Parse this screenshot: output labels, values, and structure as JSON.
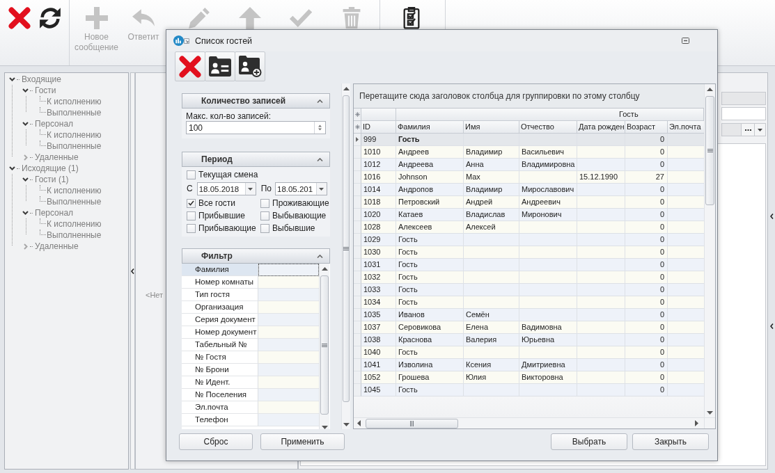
{
  "toolbar": {
    "groups": [
      {
        "buttons": [
          {
            "kind": "close",
            "disabled": false
          },
          {
            "kind": "refresh",
            "disabled": false
          }
        ]
      },
      {
        "buttons": [
          {
            "kind": "new",
            "label": "Новое сообщение",
            "disabled": true
          },
          {
            "kind": "reply",
            "label": "Ответит",
            "disabled": true
          },
          {
            "kind": "edit",
            "disabled": true
          },
          {
            "kind": "up",
            "disabled": true
          },
          {
            "kind": "confirm",
            "disabled": true
          },
          {
            "kind": "delete",
            "disabled": true
          }
        ]
      },
      {
        "buttons": [
          {
            "kind": "checklist",
            "disabled": false
          }
        ]
      }
    ]
  },
  "tree": [
    {
      "label": "Входящие",
      "expanded": true,
      "children": [
        {
          "label": "Гости",
          "expanded": true,
          "children": [
            {
              "label": "К исполнению"
            },
            {
              "label": "Выполненные"
            }
          ]
        },
        {
          "label": "Персонал",
          "expanded": true,
          "children": [
            {
              "label": "К исполнению"
            },
            {
              "label": "Выполненные"
            }
          ]
        },
        {
          "label": "Удаленные",
          "expanded": false
        }
      ]
    },
    {
      "label": "Исходящие (1)",
      "expanded": true,
      "children": [
        {
          "label": "Гости (1)",
          "expanded": true,
          "children": [
            {
              "label": "К исполнению"
            },
            {
              "label": "Выполненные"
            }
          ]
        },
        {
          "label": "Персонал",
          "expanded": true,
          "children": [
            {
              "label": "К исполнению"
            },
            {
              "label": "Выполненные"
            }
          ]
        },
        {
          "label": "Удаленные",
          "expanded": false
        }
      ]
    }
  ],
  "middle_panel": {
    "empty_text": "<Нет"
  },
  "dialog": {
    "title": "Список гостей",
    "toolbar": [
      {
        "kind": "close"
      },
      {
        "kind": "card"
      },
      {
        "kind": "add"
      }
    ],
    "records_group": {
      "title": "Количество записей",
      "expanded": true,
      "max_label": "Макс. кол-во записей:",
      "max_value": "100"
    },
    "period_group": {
      "title": "Период",
      "expanded": true,
      "current_shift": {
        "label": "Текущая смена",
        "checked": false
      },
      "from_label": "С",
      "from_date": "18.05.2018",
      "to_label": "По",
      "to_date": "18.05.201",
      "options": [
        {
          "label": "Все гости",
          "checked": true
        },
        {
          "label": "Проживающие",
          "checked": false
        },
        {
          "label": "Прибывшие",
          "checked": false
        },
        {
          "label": "Выбывающие",
          "checked": false
        },
        {
          "label": "Прибывающие",
          "checked": false
        },
        {
          "label": "Выбывшие",
          "checked": false
        }
      ]
    },
    "filter_group": {
      "title": "Фильтр",
      "expanded": true,
      "fields": [
        {
          "label": "Фамилия",
          "selected": true
        },
        {
          "label": "Номер комнаты",
          "selected": false
        },
        {
          "label": "Тип гостя",
          "selected": false
        },
        {
          "label": "Организация",
          "selected": false
        },
        {
          "label": "Серия документ",
          "selected": false
        },
        {
          "label": "Номер документ",
          "selected": false
        },
        {
          "label": "Табельный №",
          "selected": false
        },
        {
          "label": "№ Гостя",
          "selected": false
        },
        {
          "label": "№ Брони",
          "selected": false
        },
        {
          "label": "№ Идент.",
          "selected": false
        },
        {
          "label": "№ Поселения",
          "selected": false
        },
        {
          "label": "Эл.почта",
          "selected": false
        },
        {
          "label": "Телефон",
          "selected": false
        }
      ]
    },
    "left_buttons": [
      "Сброс",
      "Применить"
    ],
    "grid": {
      "group_hint": "Перетащите сюда заголовок столбца для группировки по этому столбцу",
      "band": "Гость",
      "columns": [
        "ID",
        "Фамилия",
        "Имя",
        "Отчество",
        "Дата рожден",
        "Возраст",
        "Эл.почта"
      ],
      "rows": [
        {
          "id": "999",
          "last_name": "Гость",
          "age": "0",
          "selected": true
        },
        {
          "id": "1010",
          "last_name": "Андреев",
          "first_name": "Владимир",
          "middle_name": "Васильевич",
          "age": "0",
          "selected": false
        },
        {
          "id": "1012",
          "last_name": "Андреева",
          "first_name": "Анна",
          "middle_name": "Владимировна",
          "age": "0",
          "selected": false
        },
        {
          "id": "1016",
          "last_name": "Johnson",
          "first_name": "Max",
          "birth_date": "15.12.1990",
          "age": "27",
          "selected": false
        },
        {
          "id": "1014",
          "last_name": "Андропов",
          "first_name": "Владимир",
          "middle_name": "Мирославович",
          "age": "0",
          "selected": false
        },
        {
          "id": "1018",
          "last_name": "Петровский",
          "first_name": "Андрей",
          "middle_name": "Андреевич",
          "age": "0",
          "selected": false
        },
        {
          "id": "1020",
          "last_name": "Катаев",
          "first_name": "Владислав",
          "middle_name": "Миронович",
          "age": "0",
          "selected": false
        },
        {
          "id": "1028",
          "last_name": "Алексеев",
          "first_name": "Алексей",
          "age": "0",
          "selected": false
        },
        {
          "id": "1029",
          "last_name": "Гость",
          "age": "0",
          "selected": false
        },
        {
          "id": "1030",
          "last_name": "Гость",
          "age": "0",
          "selected": false
        },
        {
          "id": "1031",
          "last_name": "Гость",
          "age": "0",
          "selected": false
        },
        {
          "id": "1032",
          "last_name": "Гость",
          "age": "0",
          "selected": false
        },
        {
          "id": "1033",
          "last_name": "Гость",
          "age": "0",
          "selected": false
        },
        {
          "id": "1034",
          "last_name": "Гость",
          "age": "0",
          "selected": false
        },
        {
          "id": "1035",
          "last_name": "Иванов",
          "first_name": "Семён",
          "age": "0",
          "selected": false
        },
        {
          "id": "1037",
          "last_name": "Серовикова",
          "first_name": "Елена",
          "middle_name": "Вадимовна",
          "age": "0",
          "selected": false
        },
        {
          "id": "1038",
          "last_name": "Краснова",
          "first_name": "Валерия",
          "middle_name": "Юрьевна",
          "age": "0",
          "selected": false
        },
        {
          "id": "1040",
          "last_name": "Гость",
          "age": "0",
          "selected": false
        },
        {
          "id": "1041",
          "last_name": "Изволина",
          "first_name": "Ксения",
          "middle_name": "Дмитриевна",
          "age": "0",
          "selected": false
        },
        {
          "id": "1052",
          "last_name": "Грошева",
          "first_name": "Юлия",
          "middle_name": "Викторовна",
          "age": "0",
          "selected": false
        },
        {
          "id": "1045",
          "last_name": "Гость",
          "age": "0",
          "selected": false
        }
      ]
    },
    "right_buttons": [
      "Выбрать",
      "Закрыть"
    ]
  }
}
